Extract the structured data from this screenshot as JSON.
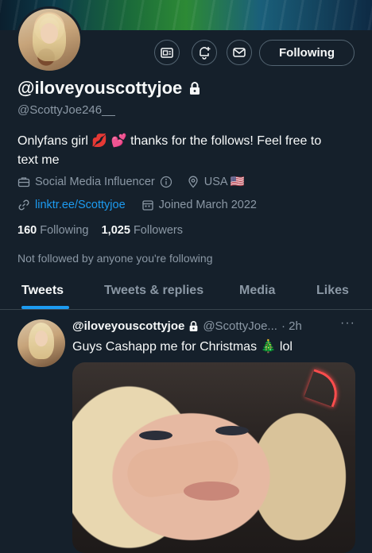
{
  "profile": {
    "display_name": "@iloveyouscottyjoe",
    "handle": "@ScottyJoe246__",
    "bio_line1": "Onlyfans girl 💋 💕  thanks for the follows! Feel free to",
    "bio_line2": "text me",
    "category": "Social Media Influencer",
    "location": "USA 🇺🇸",
    "website": "linktr.ee/Scottyjoe",
    "joined": "Joined March 2022",
    "following_count": "160",
    "following_label": "Following",
    "followers_count": "1,025",
    "followers_label": "Followers",
    "not_followed_text": "Not followed by anyone you're following"
  },
  "actions": {
    "follow_button": "Following",
    "icons": [
      "newsletter-icon",
      "notification-bell-plus-icon",
      "message-icon"
    ]
  },
  "tabs": [
    {
      "label": "Tweets",
      "active": true
    },
    {
      "label": "Tweets & replies",
      "active": false
    },
    {
      "label": "Media",
      "active": false
    },
    {
      "label": "Likes",
      "active": false
    }
  ],
  "tweet": {
    "name": "@iloveyouscottyjoe",
    "handle": "@ScottyJoe...",
    "time": "· 2h",
    "more": "···",
    "text": "Guys Cashapp me for Christmas 🎄  lol"
  },
  "colors": {
    "background": "#15202b",
    "accent": "#1d9bf0",
    "muted_text": "#8b98a5",
    "border": "#536471"
  }
}
